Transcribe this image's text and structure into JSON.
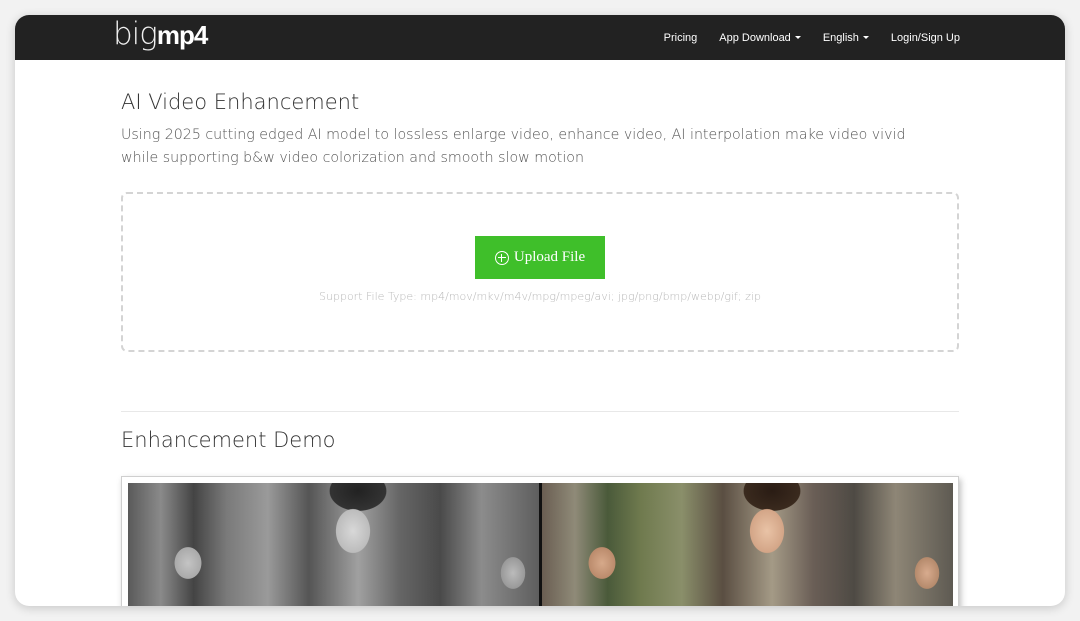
{
  "brand": {
    "logo_thin": "big",
    "logo_bold": "mp4"
  },
  "nav": {
    "items": [
      {
        "label": "Pricing",
        "dropdown": false
      },
      {
        "label": "App Download",
        "dropdown": true
      },
      {
        "label": "English",
        "dropdown": true
      },
      {
        "label": "Login/Sign Up",
        "dropdown": false
      }
    ]
  },
  "main": {
    "title": "AI Video Enhancement",
    "description": "Using 2025 cutting edged AI model to lossless enlarge video, enhance video, AI interpolation make video vivid while supporting b&w video colorization and smooth slow motion",
    "upload": {
      "button_label": "Upload File",
      "support_text": "Support File Type: mp4/mov/mkv/m4v/mpg/mpeg/avi; jpg/png/bmp/webp/gif; zip"
    },
    "demo": {
      "title": "Enhancement Demo"
    }
  },
  "colors": {
    "navbar": "#222222",
    "upload_button": "#3fbf2a",
    "background": "#ffffff"
  },
  "icons": {
    "upload": "plus-circle-icon",
    "dropdown": "caret-down-icon"
  }
}
